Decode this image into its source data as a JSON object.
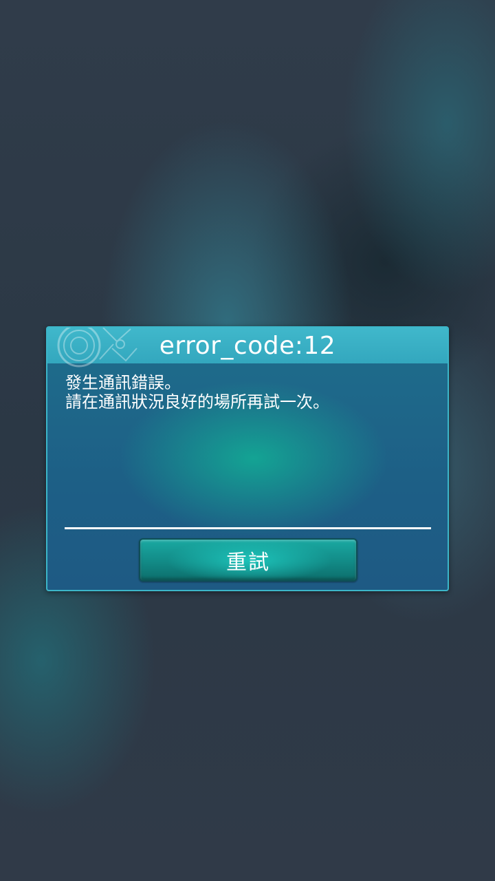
{
  "dialog": {
    "title": "error_code:12",
    "message_lines": [
      "發生通訊錯誤。",
      "請在通訊狀況良好的場所再試一次。"
    ],
    "retry_label": "重試"
  },
  "colors": {
    "header": "#3aafc4",
    "dialog_body": "#1e6287",
    "button": "#129a94",
    "text": "#ffffff"
  },
  "icons": {
    "header_ornament": "ornamental-emblem-icon"
  }
}
